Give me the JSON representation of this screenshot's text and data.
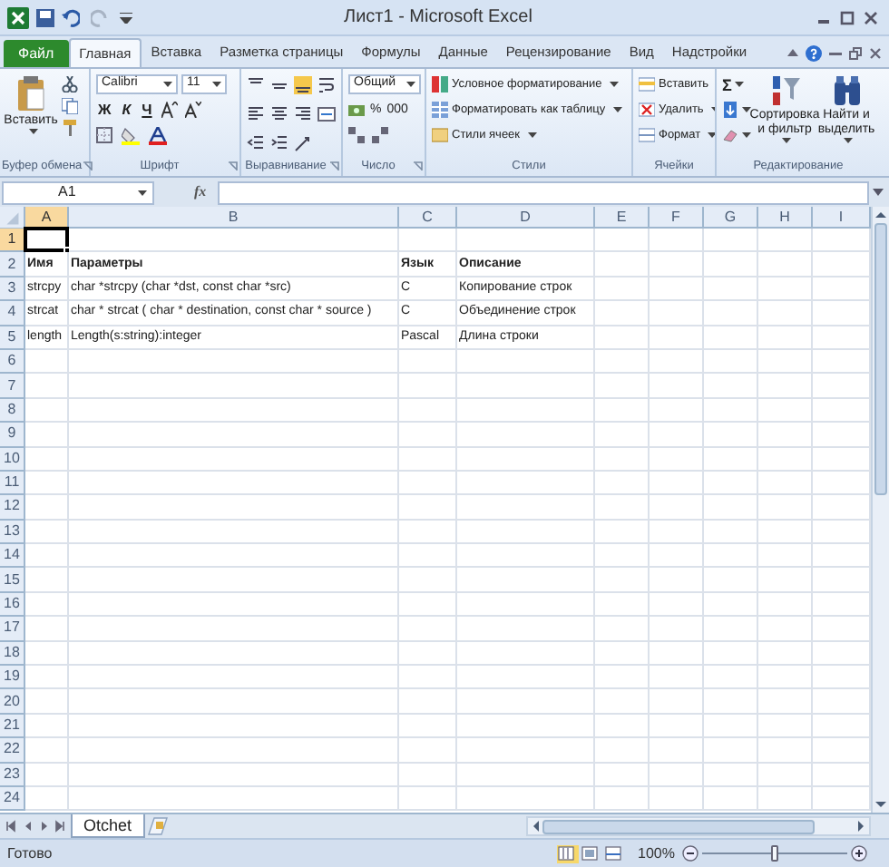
{
  "window": {
    "title": "Лист1 - Microsoft Excel"
  },
  "tabs": [
    {
      "label": "Файл",
      "kind": "file",
      "selected": false
    },
    {
      "label": "Главная",
      "kind": "tab",
      "selected": true
    },
    {
      "label": "Вставка",
      "kind": "tab",
      "selected": false
    },
    {
      "label": "Разметка страницы",
      "kind": "tab",
      "selected": false
    },
    {
      "label": "Формулы",
      "kind": "tab",
      "selected": false
    },
    {
      "label": "Данные",
      "kind": "tab",
      "selected": false
    },
    {
      "label": "Рецензирование",
      "kind": "tab",
      "selected": false
    },
    {
      "label": "Вид",
      "kind": "tab",
      "selected": false
    },
    {
      "label": "Надстройки",
      "kind": "tab",
      "selected": false
    }
  ],
  "ribbon": {
    "clipboard": {
      "label": "Буфер обмена",
      "paste": "Вставить"
    },
    "font": {
      "label": "Шрифт",
      "name": "Calibri",
      "size": "11",
      "styles": [
        "Ж",
        "К",
        "Ч"
      ]
    },
    "alignment": {
      "label": "Выравнивание"
    },
    "number": {
      "label": "Число",
      "format": "Общий",
      "buttons": [
        "%",
        "000"
      ]
    },
    "styles": {
      "label": "Стили",
      "items": [
        "Условное форматирование",
        "Форматировать как таблицу",
        "Стили ячеек"
      ]
    },
    "cells": {
      "label": "Ячейки",
      "items": [
        "Вставить",
        "Удалить",
        "Формат"
      ]
    },
    "editing": {
      "label": "Редактирование",
      "sum": "Σ",
      "sort": "Сортировка и фильтр",
      "find": "Найти и выделить"
    }
  },
  "formula_bar": {
    "name_box": "A1",
    "fx": "fx"
  },
  "sheet": {
    "columns": [
      {
        "label": "A",
        "selected": true
      },
      {
        "label": "B",
        "selected": false
      },
      {
        "label": "C",
        "selected": false
      },
      {
        "label": "D",
        "selected": false
      },
      {
        "label": "E",
        "selected": false
      },
      {
        "label": "F",
        "selected": false
      },
      {
        "label": "G",
        "selected": false
      },
      {
        "label": "H",
        "selected": false
      },
      {
        "label": "I",
        "selected": false
      }
    ],
    "rows": [
      {
        "number": "1",
        "selected": true
      },
      {
        "number": "2",
        "selected": false,
        "bold": true,
        "cells": {
          "A": "Имя",
          "B": "Параметры",
          "C": "Язык",
          "D": "Описание"
        }
      },
      {
        "number": "3",
        "selected": false,
        "bold": false,
        "cells": {
          "A": "strcpy",
          "B": "char *strcpy (char *dst, const char *src)",
          "C": "C",
          "D": "Копирование строк"
        }
      },
      {
        "number": "4",
        "selected": false,
        "bold": false,
        "cells": {
          "A": "strcat",
          "B": "char * strcat ( char * destination, const char * source )",
          "C": "C",
          "D": "Объединение строк"
        }
      },
      {
        "number": "5",
        "selected": false,
        "bold": false,
        "cells": {
          "A": "length",
          "B": "Length(s:string):integer",
          "C": "Pascal",
          "D": "Длина строки"
        }
      },
      {
        "number": "6",
        "selected": false
      },
      {
        "number": "7",
        "selected": false
      },
      {
        "number": "8",
        "selected": false
      },
      {
        "number": "9",
        "selected": false
      },
      {
        "number": "10",
        "selected": false
      },
      {
        "number": "11",
        "selected": false
      },
      {
        "number": "12",
        "selected": false
      },
      {
        "number": "13",
        "selected": false
      },
      {
        "number": "14",
        "selected": false
      },
      {
        "number": "15",
        "selected": false
      },
      {
        "number": "16",
        "selected": false
      },
      {
        "number": "17",
        "selected": false
      },
      {
        "number": "18",
        "selected": false
      },
      {
        "number": "19",
        "selected": false
      },
      {
        "number": "20",
        "selected": false
      },
      {
        "number": "21",
        "selected": false
      },
      {
        "number": "22",
        "selected": false
      },
      {
        "number": "23",
        "selected": false
      },
      {
        "number": "24",
        "selected": false
      }
    ]
  },
  "sheet_tabs": [
    {
      "label": "Otchet",
      "selected": true
    }
  ],
  "status_bar": {
    "text": "Готово",
    "views": [
      {
        "kind": "normal",
        "selected": true
      },
      {
        "kind": "page_layout",
        "selected": false
      },
      {
        "kind": "page_break",
        "selected": false
      }
    ],
    "zoom": "100%",
    "zoom_slider": {
      "level": 0.5
    }
  }
}
